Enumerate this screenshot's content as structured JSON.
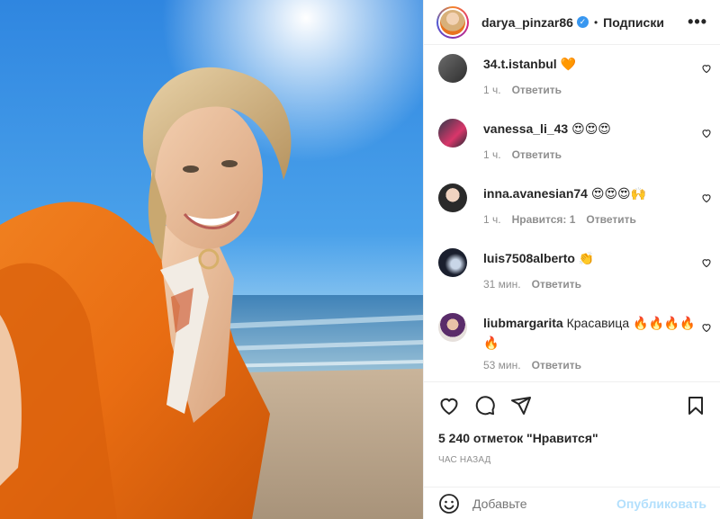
{
  "post": {
    "author": "darya_pinzar86",
    "follow_label": "Подписки",
    "dot": "•",
    "more": "•••",
    "verified_mark": "✓"
  },
  "comments": [
    {
      "user": "34.t.istanbul",
      "text": "🧡",
      "time": "1 ч.",
      "likes": "",
      "reply": "Ответить"
    },
    {
      "user": "vanessa_li_43",
      "text": "😍😍😍",
      "time": "1 ч.",
      "likes": "",
      "reply": "Ответить"
    },
    {
      "user": "inna.avanesian74",
      "text": "😍😍😍🙌",
      "time": "1 ч.",
      "likes": "Нравится: 1",
      "reply": "Ответить"
    },
    {
      "user": "luis7508alberto",
      "text": "👏",
      "time": "31 мин.",
      "likes": "",
      "reply": "Ответить"
    },
    {
      "user": "liubmargarita",
      "text": "Красавица 🔥🔥🔥🔥🔥",
      "time": "53 мин.",
      "likes": "",
      "reply": "Ответить"
    }
  ],
  "actions": {
    "icons": [
      "heart-icon",
      "comment-icon",
      "share-icon",
      "bookmark-icon"
    ],
    "likes_text": "5 240 отметок \"Нравится\"",
    "time_ago": "час назад"
  },
  "composer": {
    "placeholder": "Добавьте",
    "publish_label": "Опубликовать"
  },
  "colors": {
    "text": "#262626",
    "secondary": "#8e8e8e",
    "publish_disabled": "#b2dffc",
    "verified": "#3897f0",
    "border": "#efefef"
  }
}
